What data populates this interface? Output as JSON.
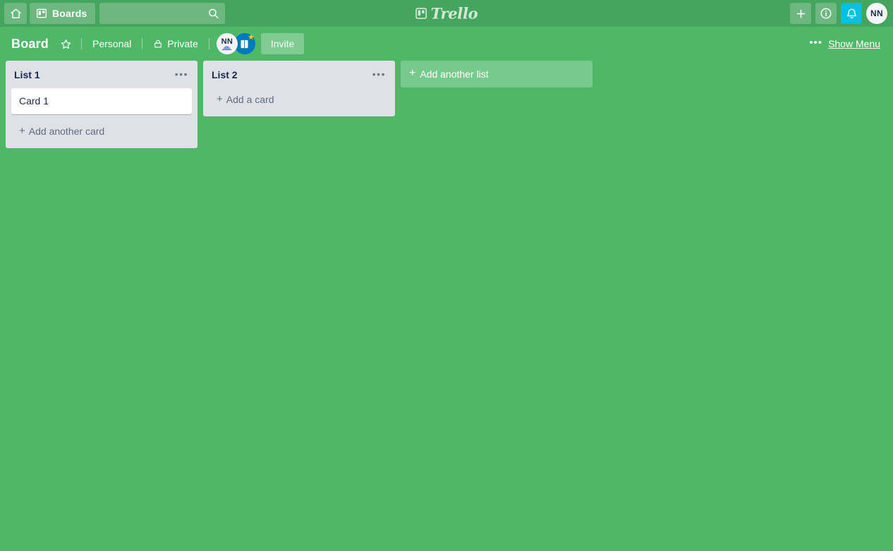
{
  "topbar": {
    "home_icon": "home-icon",
    "boards_icon": "boards-grid-icon",
    "boards_label": "Boards",
    "search": {
      "value": "",
      "placeholder": ""
    },
    "search_icon": "search-icon",
    "logo_icon": "trello-logo-icon",
    "logo_text": "Trello",
    "add_icon": "plus-icon",
    "info_icon": "info-circle-icon",
    "notifications_icon": "bell-icon",
    "notifications_color": "#00C2E0",
    "avatar_initials": "NN"
  },
  "boardbar": {
    "title": "Board",
    "star_icon": "star-icon",
    "team_label": "Personal",
    "lock_icon": "lock-icon",
    "visibility_label": "Private",
    "member_initials": "NN",
    "member_badge_icon": "board-badge-icon",
    "member_badge_star_icon": "star-badge-icon",
    "member_badge_color": "#0079BF",
    "invite_label": "Invite",
    "menu_dots_icon": "ellipsis-icon",
    "show_menu_label": "Show Menu"
  },
  "board": {
    "background_color": "#4EB868",
    "topbar_color": "#45A55E",
    "list_color": "#DFE1E6",
    "lists": [
      {
        "title": "List 1",
        "menu_icon": "ellipsis-icon",
        "cards": [
          {
            "title": "Card 1"
          }
        ],
        "add_card_label": "Add another card"
      },
      {
        "title": "List 2",
        "menu_icon": "ellipsis-icon",
        "cards": [],
        "add_card_label": "Add a card"
      }
    ],
    "add_list_label": "Add another list"
  }
}
